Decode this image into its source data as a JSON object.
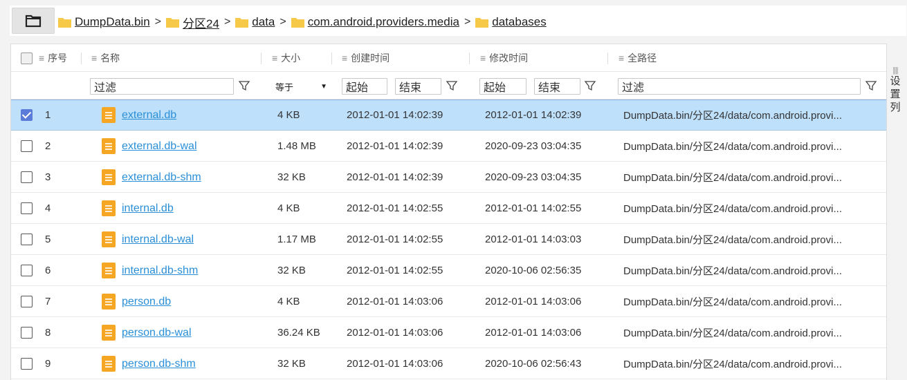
{
  "breadcrumb": [
    {
      "label": "DumpData.bin"
    },
    {
      "label": "分区24"
    },
    {
      "label": "data"
    },
    {
      "label": "com.android.providers.media"
    },
    {
      "label": "databases"
    }
  ],
  "breadcrumb_separator": ">",
  "columns": {
    "index": "序号",
    "name": "名称",
    "size": "大小",
    "created": "创建时间",
    "modified": "修改时间",
    "full_path": "全路径"
  },
  "filters": {
    "name_placeholder": "过滤",
    "size_operator": "等于",
    "created_start": "起始",
    "created_end": "结束",
    "modified_start": "起始",
    "modified_end": "结束",
    "path_placeholder": "过滤"
  },
  "side_settings": "设置列",
  "rows": [
    {
      "index": "1",
      "name": "external.db",
      "size": "4 KB",
      "created": "2012-01-01 14:02:39",
      "modified": "2012-01-01 14:02:39",
      "path": "DumpData.bin/分区24/data/com.android.provi...",
      "selected": true
    },
    {
      "index": "2",
      "name": "external.db-wal",
      "size": "1.48 MB",
      "created": "2012-01-01 14:02:39",
      "modified": "2020-09-23 03:04:35",
      "path": "DumpData.bin/分区24/data/com.android.provi...",
      "selected": false
    },
    {
      "index": "3",
      "name": "external.db-shm",
      "size": "32 KB",
      "created": "2012-01-01 14:02:39",
      "modified": "2020-09-23 03:04:35",
      "path": "DumpData.bin/分区24/data/com.android.provi...",
      "selected": false
    },
    {
      "index": "4",
      "name": "internal.db",
      "size": "4 KB",
      "created": "2012-01-01 14:02:55",
      "modified": "2012-01-01 14:02:55",
      "path": "DumpData.bin/分区24/data/com.android.provi...",
      "selected": false
    },
    {
      "index": "5",
      "name": "internal.db-wal",
      "size": "1.17 MB",
      "created": "2012-01-01 14:02:55",
      "modified": "2012-01-01 14:03:03",
      "path": "DumpData.bin/分区24/data/com.android.provi...",
      "selected": false
    },
    {
      "index": "6",
      "name": "internal.db-shm",
      "size": "32 KB",
      "created": "2012-01-01 14:02:55",
      "modified": "2020-10-06 02:56:35",
      "path": "DumpData.bin/分区24/data/com.android.provi...",
      "selected": false
    },
    {
      "index": "7",
      "name": "person.db",
      "size": "4 KB",
      "created": "2012-01-01 14:03:06",
      "modified": "2012-01-01 14:03:06",
      "path": "DumpData.bin/分区24/data/com.android.provi...",
      "selected": false
    },
    {
      "index": "8",
      "name": "person.db-wal",
      "size": "36.24 KB",
      "created": "2012-01-01 14:03:06",
      "modified": "2012-01-01 14:03:06",
      "path": "DumpData.bin/分区24/data/com.android.provi...",
      "selected": false
    },
    {
      "index": "9",
      "name": "person.db-shm",
      "size": "32 KB",
      "created": "2012-01-01 14:03:06",
      "modified": "2020-10-06 02:56:43",
      "path": "DumpData.bin/分区24/data/com.android.provi...",
      "selected": false
    }
  ],
  "colors": {
    "selected_row": "#bfe0fb",
    "checkbox_checked": "#5a7bd8",
    "file_icon": "#f5a623",
    "folder_icon": "#f7c948",
    "link": "#2a8fd8"
  },
  "icons": {
    "folder_button": "folder-outline-icon",
    "crumb": "folder-icon",
    "file": "document-icon",
    "filter": "funnel-icon",
    "column": "hamburger-icon"
  }
}
